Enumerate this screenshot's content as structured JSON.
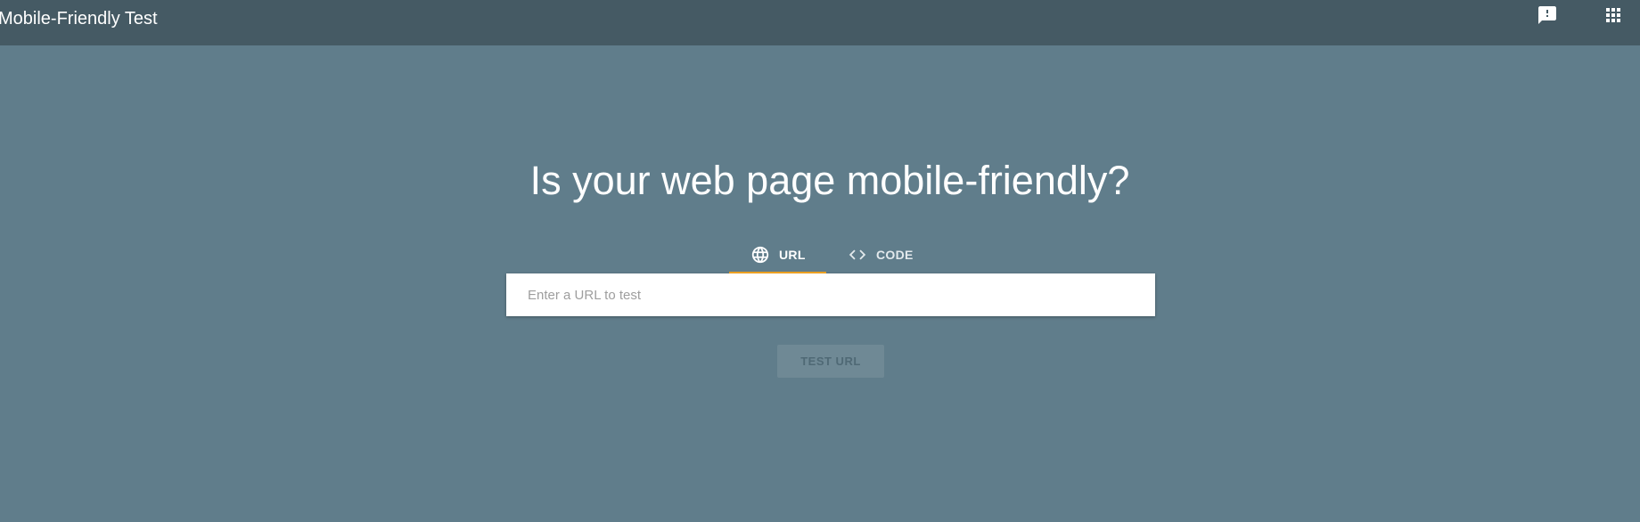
{
  "header": {
    "app_title": "Mobile-Friendly Test",
    "feedback_icon": "feedback-icon",
    "apps_icon": "apps-grid-icon"
  },
  "main": {
    "headline": "Is your web page mobile-friendly?",
    "tabs": [
      {
        "label": "URL",
        "icon": "globe-icon",
        "selected": true
      },
      {
        "label": "CODE",
        "icon": "code-icon",
        "selected": false
      }
    ],
    "url_input": {
      "value": "",
      "placeholder": "Enter a URL to test"
    },
    "test_button_label": "TEST URL"
  },
  "colors": {
    "page_background": "#607d8b",
    "appbar_background": "#455a64",
    "tab_indicator": "#f5a623",
    "disabled_button": "#6f8995"
  }
}
